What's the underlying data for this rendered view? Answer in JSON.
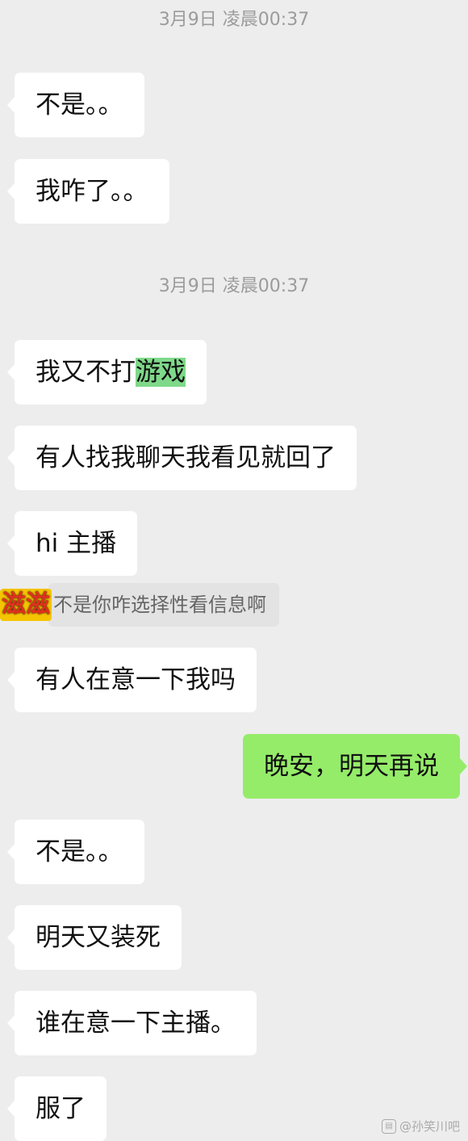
{
  "timestamps": [
    "3月9日 凌晨00:37",
    "3月9日 凌晨00:37"
  ],
  "messages": [
    {
      "side": "left",
      "text": "不是。。"
    },
    {
      "side": "left",
      "text": "我咋了。。"
    },
    {
      "side": "left",
      "text": "我又不打",
      "highlight": "游戏"
    },
    {
      "side": "left",
      "text": "有人找我聊天我看见就回了"
    },
    {
      "side": "left",
      "text": "hi 主播"
    },
    {
      "side": "left",
      "text": "有人在意一下我吗"
    },
    {
      "side": "right",
      "text": "晚安，明天再说"
    },
    {
      "side": "left",
      "text": "不是。。"
    },
    {
      "side": "left",
      "text": "明天又装死"
    },
    {
      "side": "left",
      "text": "谁在意一下主播。"
    },
    {
      "side": "left",
      "text": "服了"
    }
  ],
  "danmaku": {
    "logo_text": "滋滋",
    "text": "不是你咋选择性看信息啊"
  },
  "watermark": {
    "icon": "chat-icon",
    "text": "@孙笑川吧"
  },
  "colors": {
    "background": "#ededed",
    "left_bubble": "#ffffff",
    "right_bubble": "#95ec69",
    "highlight": "#7fd98a"
  }
}
